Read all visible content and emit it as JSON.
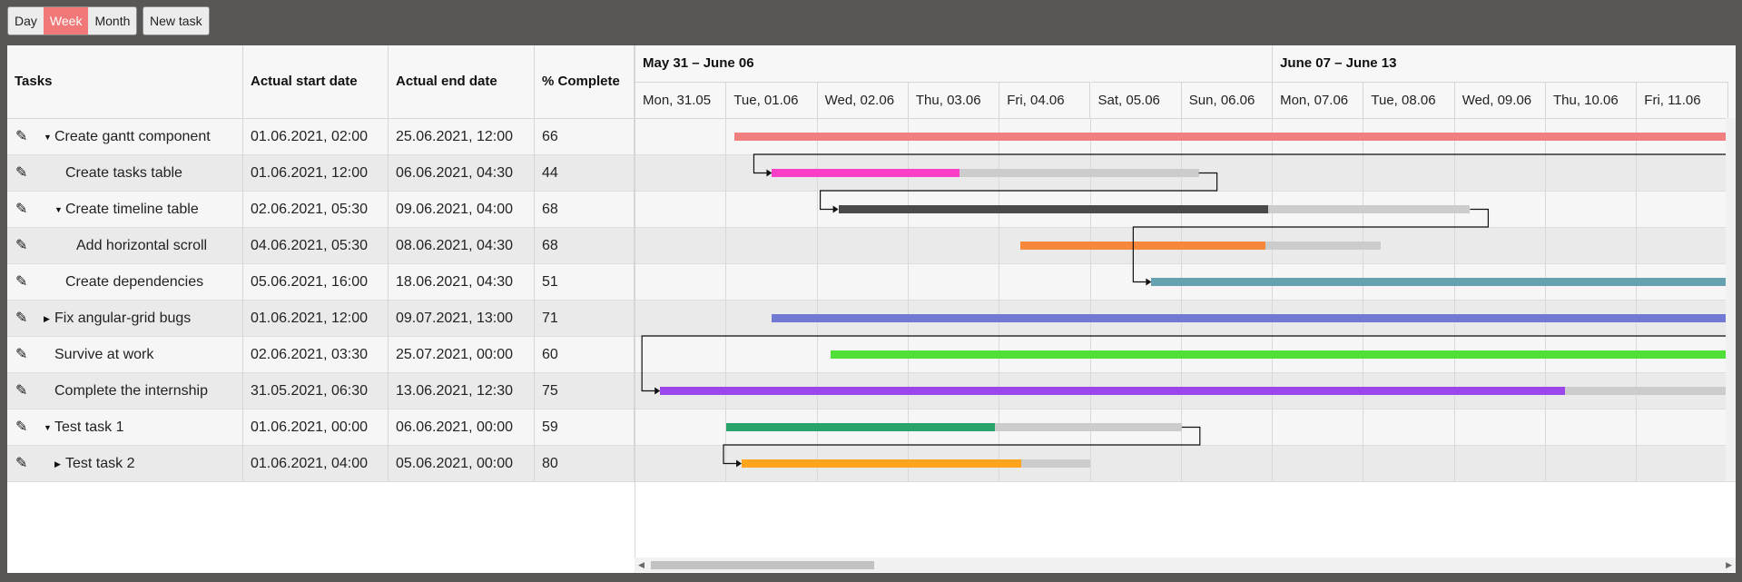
{
  "toolbar": {
    "views": [
      {
        "label": "Day",
        "active": false
      },
      {
        "label": "Week",
        "active": true
      },
      {
        "label": "Month",
        "active": false
      }
    ],
    "new_task_label": "New task"
  },
  "table": {
    "headers": [
      "Tasks",
      "Actual start date",
      "Actual end date",
      "% Complete"
    ],
    "rows": [
      {
        "name": "Create gantt component",
        "level": 0,
        "toggle": "expanded",
        "start": "01.06.2021, 02:00",
        "end": "25.06.2021, 12:00",
        "complete": "66"
      },
      {
        "name": "Create tasks table",
        "level": 1,
        "toggle": "none",
        "start": "01.06.2021, 12:00",
        "end": "06.06.2021, 04:30",
        "complete": "44"
      },
      {
        "name": "Create timeline table",
        "level": 1,
        "toggle": "expanded",
        "start": "02.06.2021, 05:30",
        "end": "09.06.2021, 04:00",
        "complete": "68"
      },
      {
        "name": "Add horizontal scroll",
        "level": 2,
        "toggle": "none",
        "start": "04.06.2021, 05:30",
        "end": "08.06.2021, 04:30",
        "complete": "68"
      },
      {
        "name": "Create dependencies",
        "level": 1,
        "toggle": "none",
        "start": "05.06.2021, 16:00",
        "end": "18.06.2021, 04:30",
        "complete": "51"
      },
      {
        "name": "Fix angular-grid bugs",
        "level": 0,
        "toggle": "collapsed",
        "start": "01.06.2021, 12:00",
        "end": "09.07.2021, 13:00",
        "complete": "71"
      },
      {
        "name": "Survive at work",
        "level": 0,
        "toggle": "none",
        "start": "02.06.2021, 03:30",
        "end": "25.07.2021, 00:00",
        "complete": "60"
      },
      {
        "name": "Complete the internship",
        "level": 0,
        "toggle": "none",
        "start": "31.05.2021, 06:30",
        "end": "13.06.2021, 12:30",
        "complete": "75"
      },
      {
        "name": "Test task 1",
        "level": 0,
        "toggle": "expanded",
        "start": "01.06.2021, 00:00",
        "end": "06.06.2021, 00:00",
        "complete": "59"
      },
      {
        "name": "Test task 2",
        "level": 1,
        "toggle": "collapsed",
        "start": "01.06.2021, 04:00",
        "end": "05.06.2021, 00:00",
        "complete": "80"
      }
    ]
  },
  "timeline": {
    "weeks": [
      "May 31 – June 06",
      "June 07 – June 13"
    ],
    "days": [
      "Mon, 31.05",
      "Tue, 01.06",
      "Wed, 02.06",
      "Thu, 03.06",
      "Fri, 04.06",
      "Sat, 05.06",
      "Sun, 06.06",
      "Mon, 07.06",
      "Tue, 08.06",
      "Wed, 09.06",
      "Thu, 10.06",
      "Fri, 11.06"
    ],
    "bars": [
      {
        "start": "2021-06-01T02:00",
        "end": "2021-06-25T12:00",
        "complete": 66,
        "color": "#f08080"
      },
      {
        "start": "2021-06-01T12:00",
        "end": "2021-06-06T04:30",
        "complete": 44,
        "color": "#f93fc8"
      },
      {
        "start": "2021-06-02T05:30",
        "end": "2021-06-09T04:00",
        "complete": 68,
        "color": "#4a4a4a"
      },
      {
        "start": "2021-06-04T05:30",
        "end": "2021-06-08T04:30",
        "complete": 68,
        "color": "#f7873a"
      },
      {
        "start": "2021-06-05T16:00",
        "end": "2021-06-18T04:30",
        "complete": 51,
        "color": "#66a1af"
      },
      {
        "start": "2021-06-01T12:00",
        "end": "2021-07-09T13:00",
        "complete": 71,
        "color": "#7279d3"
      },
      {
        "start": "2021-06-02T03:30",
        "end": "2021-07-25T00:00",
        "complete": 60,
        "color": "#50e038"
      },
      {
        "start": "2021-05-31T06:30",
        "end": "2021-06-13T12:30",
        "complete": 75,
        "color": "#9a46ea"
      },
      {
        "start": "2021-06-01T00:00",
        "end": "2021-06-06T00:00",
        "complete": 59,
        "color": "#2aa36a"
      },
      {
        "start": "2021-06-01T04:00",
        "end": "2021-06-05T00:00",
        "complete": 80,
        "color": "#ffa41c"
      }
    ],
    "links": [
      [
        0,
        1
      ],
      [
        1,
        2
      ],
      [
        2,
        4
      ],
      [
        5,
        7
      ],
      [
        8,
        9
      ]
    ]
  }
}
